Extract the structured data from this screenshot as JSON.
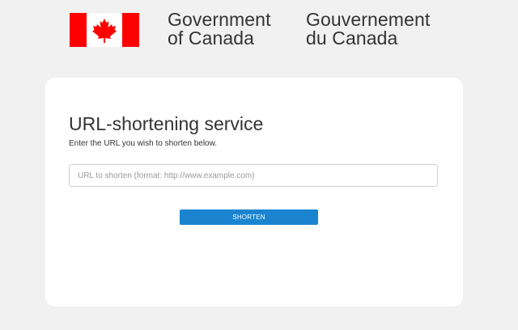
{
  "header": {
    "flag_icon": "canada-flag-icon",
    "wordmark_en": [
      "Government",
      "of Canada"
    ],
    "wordmark_fr": [
      "Gouvernement",
      "du Canada"
    ],
    "flag_color": "#ff0000"
  },
  "form": {
    "title": "URL-shortening service",
    "subtitle": "Enter the URL you wish to shorten below.",
    "url_input": {
      "value": "",
      "placeholder": "URL to shorten (format: http://www.example.com)"
    },
    "submit_label": "SHORTEN"
  },
  "colors": {
    "page_background": "#f1f1f1",
    "card_background": "#ffffff",
    "accent": "#1b84d0"
  }
}
